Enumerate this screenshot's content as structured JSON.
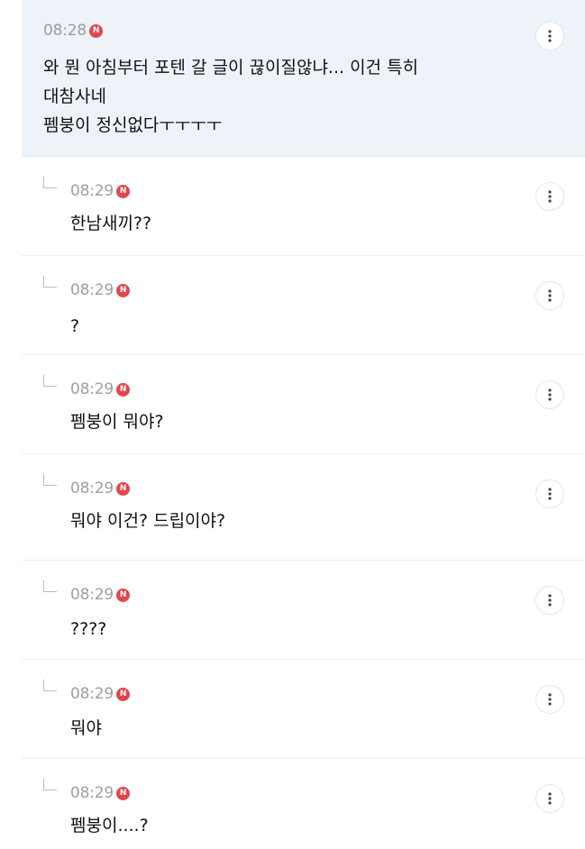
{
  "main_comment": {
    "time": "08:28",
    "badge": "N",
    "lines": [
      "와 뭔 아침부터 포텐 갈 글이 끊이질않냐... 이건 특히",
      "대참사네",
      "펨붕이 정신없다ㅜㅜㅜㅜ"
    ]
  },
  "replies": [
    {
      "time": "08:29",
      "badge": "N",
      "text": "한남새끼??"
    },
    {
      "time": "08:29",
      "badge": "N",
      "text": "?"
    },
    {
      "time": "08:29",
      "badge": "N",
      "text": "펨붕이 뭐야?"
    },
    {
      "time": "08:29",
      "badge": "N",
      "text": "뭐야 이건? 드립이야?"
    },
    {
      "time": "08:29",
      "badge": "N",
      "text": "????"
    },
    {
      "time": "08:29",
      "badge": "N",
      "text": "뭐야"
    },
    {
      "time": "08:29",
      "badge": "N",
      "text": "펨붕이....?"
    }
  ],
  "icons": {
    "more": "more-vertical-icon",
    "reply": "reply-arrow-icon",
    "badge": "new-badge-icon"
  },
  "colors": {
    "main_bg": "#eef3f9",
    "badge": "#e0474c",
    "time": "#9aa0a6",
    "text": "#111111"
  }
}
